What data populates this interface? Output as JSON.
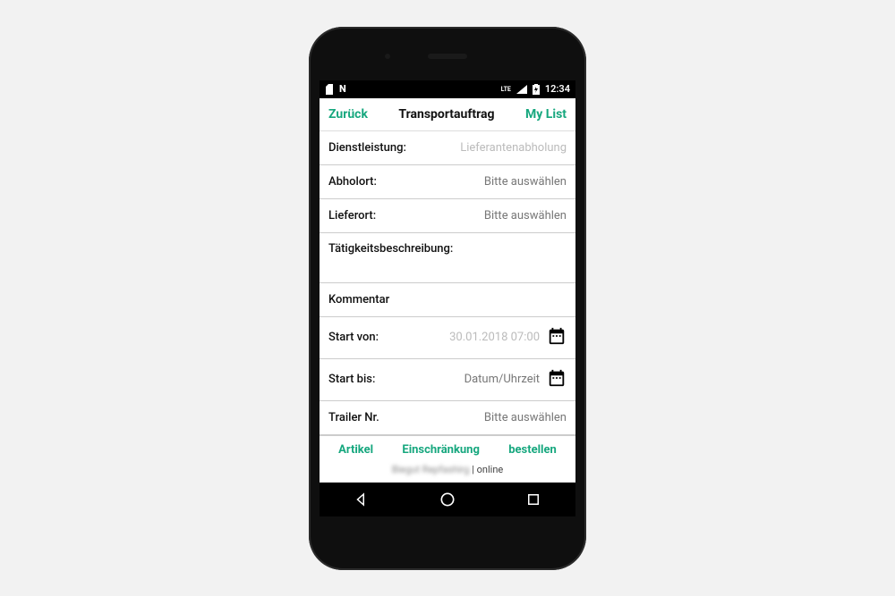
{
  "statusbar": {
    "time": "12:34",
    "lte": "LTE"
  },
  "header": {
    "back": "Zurück",
    "title": "Transportauftrag",
    "right": "My List"
  },
  "fields": {
    "dienstleistung": {
      "label": "Dienstleistung:",
      "value": "Lieferantenabholung"
    },
    "abholort": {
      "label": "Abholort:",
      "value": "Bitte auswählen"
    },
    "lieferort": {
      "label": "Lieferort:",
      "value": "Bitte auswählen"
    },
    "beschreibung": {
      "label": "Tätigkeitsbeschreibung:"
    },
    "kommentar": {
      "label": "Kommentar"
    },
    "start_von": {
      "label": "Start von:",
      "value": "30.01.2018 07:00"
    },
    "start_bis": {
      "label": "Start bis:",
      "value": "Datum/Uhrzeit"
    },
    "trailer": {
      "label": "Trailer Nr.",
      "value": "Bitte auswählen"
    }
  },
  "tabs": {
    "artikel": "Artikel",
    "einschraenkung": "Einschränkung",
    "bestellen": "bestellen"
  },
  "footer": {
    "blurred": "Biegut Repfashirg",
    "status": " | online"
  }
}
